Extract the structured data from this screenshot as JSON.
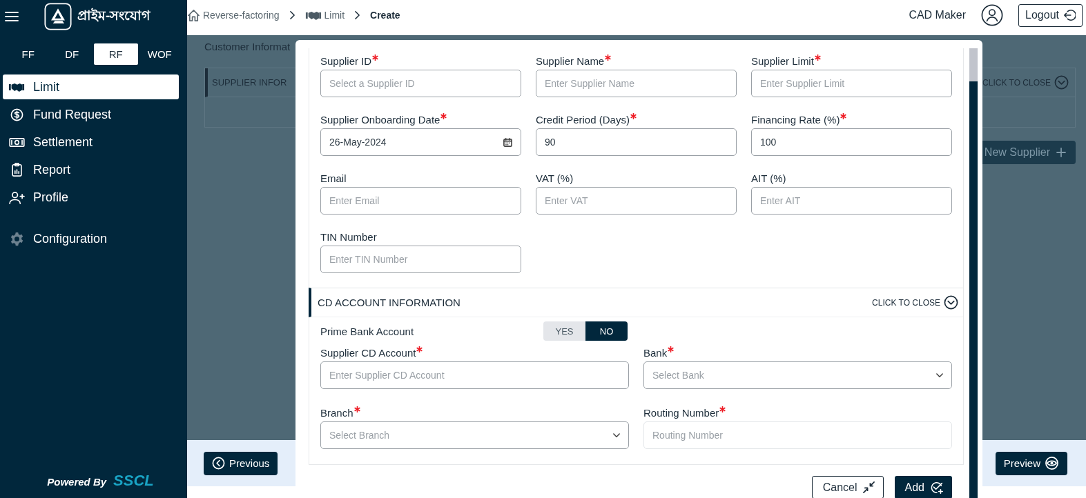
{
  "sidebar": {
    "brand": "প্রাইম-সংযোগ",
    "modules": [
      {
        "label": "FF",
        "selected": false
      },
      {
        "label": "DF",
        "selected": false
      },
      {
        "label": "RF",
        "selected": true
      },
      {
        "label": "WOF",
        "selected": false
      }
    ],
    "nav": [
      {
        "label": "Limit",
        "selected": true
      },
      {
        "label": "Fund Request",
        "selected": false
      },
      {
        "label": "Settlement",
        "selected": false
      },
      {
        "label": "Report",
        "selected": false
      },
      {
        "label": "Profile",
        "selected": false
      }
    ],
    "settings": [
      {
        "label": "Configuration",
        "selected": false
      }
    ],
    "powered_by": "Powered By",
    "vendor": "SSCL"
  },
  "topbar": {
    "breadcrumb": [
      {
        "label": "Reverse-factoring",
        "current": false
      },
      {
        "label": "Limit",
        "current": false
      },
      {
        "label": "Create",
        "current": true
      }
    ],
    "user": "CAD Maker",
    "logout": "Logout"
  },
  "page": {
    "heading": "Customer Informat",
    "panel_title": "SUPPLIER INFOR",
    "panel_toggle": "CLICK TO CLOSE",
    "new_button": "New Supplier",
    "previous": "Previous",
    "preview": "Preview"
  },
  "modal": {
    "fields": [
      {
        "label": "Supplier ID",
        "required": true,
        "kind": "text",
        "placeholder": "Select a Supplier ID"
      },
      {
        "label": "Supplier Name",
        "required": true,
        "kind": "text",
        "placeholder": "Enter Supplier Name"
      },
      {
        "label": "Supplier Limit",
        "required": true,
        "kind": "text",
        "placeholder": "Enter Supplier Limit"
      },
      {
        "label": "Supplier Onboarding Date",
        "required": true,
        "kind": "date",
        "value": "26-May-2024"
      },
      {
        "label": "Credit Period (Days)",
        "required": true,
        "kind": "text",
        "value": "90"
      },
      {
        "label": "Financing Rate (%)",
        "required": true,
        "kind": "text",
        "value": "100"
      },
      {
        "label": "Email",
        "required": false,
        "kind": "text",
        "placeholder": "Enter Email"
      },
      {
        "label": "VAT (%)",
        "required": false,
        "kind": "text",
        "placeholder": "Enter VAT"
      },
      {
        "label": "AIT (%)",
        "required": false,
        "kind": "text",
        "placeholder": "Enter AIT"
      },
      {
        "label": "TIN Number",
        "required": false,
        "kind": "text",
        "placeholder": "Enter TIN Number"
      }
    ],
    "section": {
      "title": "CD ACCOUNT INFORMATION",
      "toggle": "CLICK TO CLOSE",
      "switch_label": "Prime Bank Account",
      "options": [
        {
          "label": "YES",
          "selected": false
        },
        {
          "label": "NO",
          "selected": true
        }
      ],
      "fields": [
        {
          "label": "Supplier CD Account",
          "required": true,
          "kind": "text",
          "placeholder": "Enter Supplier CD Account",
          "disabled": false
        },
        {
          "label": "Bank",
          "required": true,
          "kind": "select",
          "placeholder": "Select Bank",
          "disabled": false
        },
        {
          "label": "Branch",
          "required": true,
          "kind": "select",
          "placeholder": "Select Branch",
          "disabled": false
        },
        {
          "label": "Routing Number",
          "required": true,
          "kind": "text",
          "placeholder": "Routing Number",
          "disabled": true
        }
      ]
    },
    "buttons": [
      {
        "label": "Cancel",
        "kind": "secondary"
      },
      {
        "label": "Add",
        "kind": "primary"
      }
    ]
  }
}
